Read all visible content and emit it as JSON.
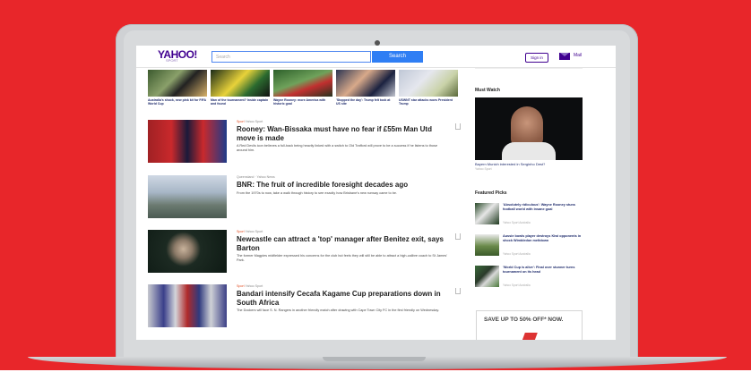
{
  "header": {
    "logo": "YAHOO!",
    "logo_sub": "SPORT",
    "search_placeholder": "Search",
    "search_button": "Search",
    "signin_label": "Sign in",
    "mail_label": "Mail"
  },
  "top_strip": [
    {
      "caption": "Australia's shock, new pink kit for FIFA World Cup"
    },
    {
      "caption": "Man of the tournament? Inside captain and found"
    },
    {
      "caption": "Wayne Rooney: more America with historic goal"
    },
    {
      "caption": "'Stopped the day': Trump felt took at US site"
    },
    {
      "caption": "USWNT star attacks woes President Trump"
    }
  ],
  "stories": [
    {
      "meta_source": "Sport",
      "meta_time": "Yahoo Sport",
      "headline": "Rooney: Wan-Bissaka must have no fear if £55m Man Utd move is made",
      "summary": "A Red Devils icon believes a full-back being heavily linked with a switch to Old Trafford will prove to be a success if he listens to those around him."
    },
    {
      "meta_source": "",
      "meta_time": "Queensland · Yahoo News",
      "headline": "BNR: The fruit of incredible foresight decades ago",
      "summary": "From the 1970s to now, take a walk through history to see exactly how Brisbane's new runway came to be."
    },
    {
      "meta_source": "Sport",
      "meta_time": "Yahoo Sport",
      "headline": "Newcastle can attract a 'top' manager after Benitez exit, says Barton",
      "summary": "The former Magpies midfielder expressed his concerns for the club but feels they will still be able to attract a high-calibre coach to St James' Park."
    },
    {
      "meta_source": "Sport",
      "meta_time": "Yahoo Sport",
      "headline": "Bandari intensify Cecafa Kagame Cup preparations down in South Africa",
      "summary": "The Dockers will face S. N. Rangers in another friendly match after drawing with Cape Town City FC in the first friendly on Wednesday."
    }
  ],
  "sidebar": {
    "must_watch_title": "Must Watch",
    "must_watch_caption": "Bayern Munich interested in Serginho Dest?",
    "must_watch_source": "Yahoo Sport",
    "featured_title": "Featured Picks",
    "featured": [
      {
        "title": "'Absolutely ridiculous': Wayne Rooney stuns football world with insane goal",
        "source": "Yahoo Sport Australia"
      },
      {
        "title": "Aussie bowls player destroys Kiwi opponents in shock Wimbledon meltdown",
        "source": "Yahoo Sport Australia"
      },
      {
        "title": "'World Cup is alive': Final over stunner turns tournament on its head",
        "source": "Yahoo Sport Australia"
      }
    ],
    "ad_text": "SAVE UP TO 50% OFF* NOW."
  },
  "colors": {
    "background": "#e8262a",
    "brand": "#400090",
    "search_blue": "#2f7ef4"
  }
}
